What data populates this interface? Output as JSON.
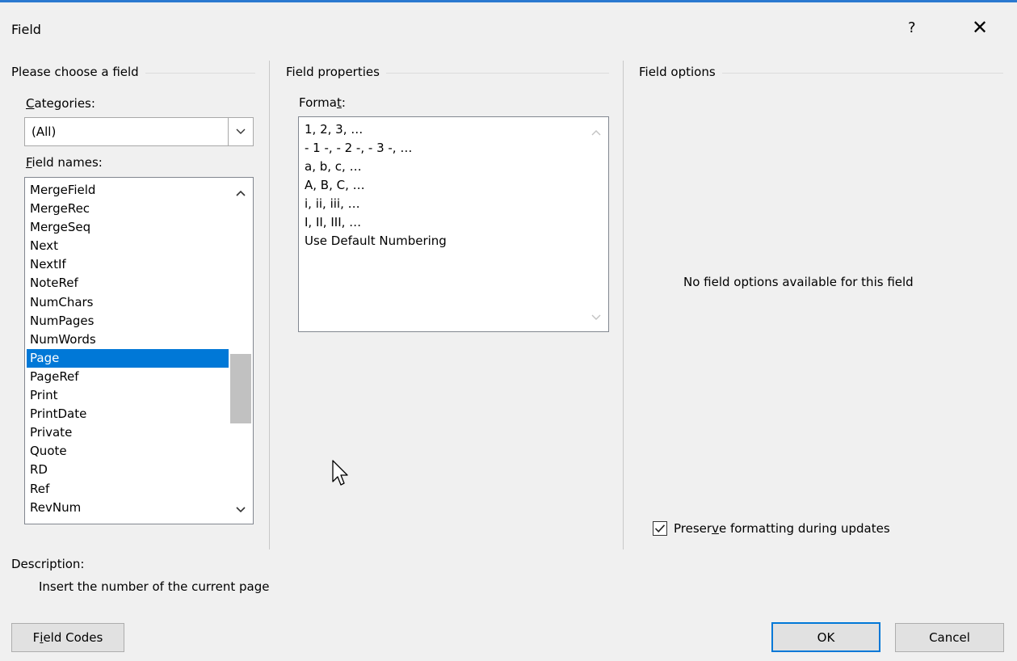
{
  "dialog": {
    "title": "Field",
    "help_label": "?",
    "close_label": "✕"
  },
  "left": {
    "group_label": "Please choose a field",
    "categories_label": {
      "mnemonic": "C",
      "rest": "ategories:"
    },
    "categories_value": "(All)",
    "field_names_label": {
      "mnemonic": "F",
      "rest": "ield names:"
    },
    "field_names": [
      "MergeField",
      "MergeRec",
      "MergeSeq",
      "Next",
      "NextIf",
      "NoteRef",
      "NumChars",
      "NumPages",
      "NumWords",
      "Page",
      "PageRef",
      "Print",
      "PrintDate",
      "Private",
      "Quote",
      "RD",
      "Ref",
      "RevNum"
    ],
    "selected_field": "Page"
  },
  "middle": {
    "group_label": "Field properties",
    "format_label": {
      "before": "Forma",
      "mnemonic": "t",
      "after": ":"
    },
    "formats": [
      "1, 2, 3, …",
      "- 1 -, - 2 -, - 3 -, …",
      "a, b, c, …",
      "A, B, C, …",
      "i, ii, iii, …",
      "I, II, III, …",
      "Use Default Numbering"
    ]
  },
  "right": {
    "group_label": "Field options",
    "no_options_text": "No field options available for this field",
    "preserve_label": {
      "before": "Preser",
      "mnemonic": "v",
      "after": "e formatting during updates"
    },
    "preserve_checked": true
  },
  "description": {
    "heading": "Description:",
    "text": "Insert the number of the current page"
  },
  "buttons": {
    "field_codes": {
      "before": "F",
      "mnemonic": "i",
      "after": "eld Codes"
    },
    "ok": "OK",
    "cancel": "Cancel"
  },
  "colors": {
    "accent": "#0078d7",
    "title_bar_line": "#2b79d0",
    "dialog_bg": "#f0f0f0"
  }
}
